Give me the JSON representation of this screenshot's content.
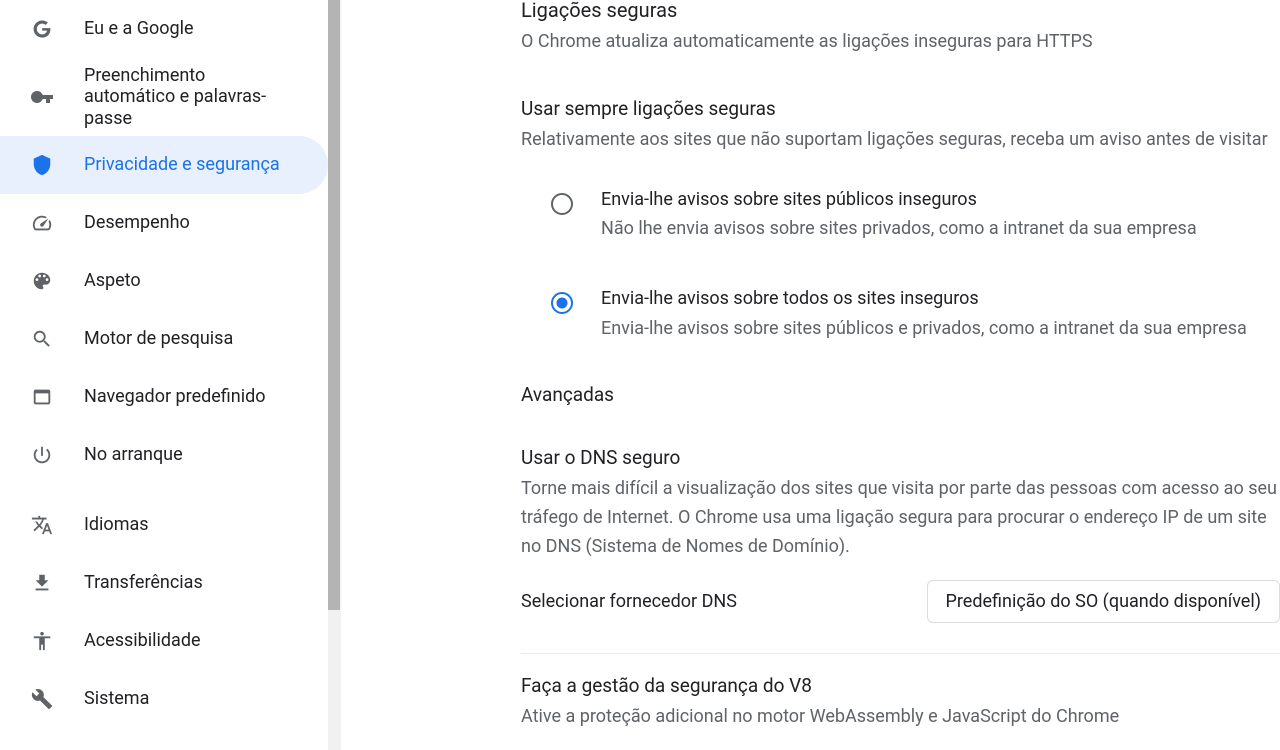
{
  "sidebar": {
    "items": [
      {
        "label": "Eu e a Google",
        "icon": "google"
      },
      {
        "label": "Preenchimento automático e palavras-passe",
        "icon": "key"
      },
      {
        "label": "Privacidade e segurança",
        "icon": "shield"
      },
      {
        "label": "Desempenho",
        "icon": "speed"
      },
      {
        "label": "Aspeto",
        "icon": "palette"
      },
      {
        "label": "Motor de pesquisa",
        "icon": "search"
      },
      {
        "label": "Navegador predefinido",
        "icon": "browser"
      },
      {
        "label": "No arranque",
        "icon": "power"
      },
      {
        "label": "Idiomas",
        "icon": "language"
      },
      {
        "label": "Transferências",
        "icon": "download"
      },
      {
        "label": "Acessibilidade",
        "icon": "accessibility"
      },
      {
        "label": "Sistema",
        "icon": "wrench"
      }
    ]
  },
  "main": {
    "secureConnections": {
      "title": "Ligações seguras",
      "desc": "O Chrome atualiza automaticamente as ligações inseguras para HTTPS"
    },
    "alwaysSecure": {
      "title": "Usar sempre ligações seguras",
      "desc": "Relativamente aos sites que não suportam ligações seguras, receba um aviso antes de visitar",
      "option1": {
        "label": "Envia-lhe avisos sobre sites públicos inseguros",
        "sub": "Não lhe envia avisos sobre sites privados, como a intranet da sua empresa"
      },
      "option2": {
        "label": "Envia-lhe avisos sobre todos os sites inseguros",
        "sub": "Envia-lhe avisos sobre sites públicos e privados, como a intranet da sua empresa"
      }
    },
    "advanced": {
      "header": "Avançadas",
      "secureDns": {
        "title": "Usar o DNS seguro",
        "desc": "Torne mais difícil a visualização dos sites que visita por parte das pessoas com acesso ao seu tráfego de Internet. O Chrome usa uma ligação segura para procurar o endereço IP de um site no DNS (Sistema de Nomes de Domínio)."
      },
      "dnsProvider": {
        "label": "Selecionar fornecedor DNS",
        "value": "Predefinição do SO (quando disponível)"
      },
      "v8": {
        "title": "Faça a gestão da segurança do V8",
        "desc": "Ative a proteção adicional no motor WebAssembly e JavaScript do Chrome"
      }
    }
  }
}
